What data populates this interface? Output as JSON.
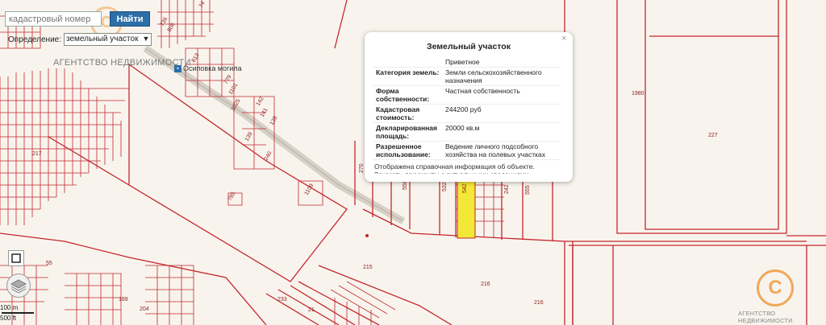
{
  "search": {
    "placeholder": "кадастровый номер",
    "find_label": "Найти"
  },
  "mode": {
    "label": "Определение:",
    "selected": "земельный участок"
  },
  "agency": {
    "name": "АГЕНТСТВО НЕДВИЖИМОСТИ",
    "logo_letter": "С"
  },
  "map": {
    "place_name": "Осиповка могила",
    "parcels": [
      {
        "id": "1980"
      },
      {
        "id": "227"
      },
      {
        "id": "216"
      },
      {
        "id": "216b",
        "label": "216"
      },
      {
        "id": "215"
      },
      {
        "id": "233"
      },
      {
        "id": "21"
      },
      {
        "id": "204"
      },
      {
        "id": "189"
      },
      {
        "id": "55"
      },
      {
        "id": "217"
      },
      {
        "id": "785"
      },
      {
        "id": "1109"
      },
      {
        "id": "240"
      },
      {
        "id": "128"
      },
      {
        "id": "139"
      },
      {
        "id": "141"
      },
      {
        "id": "142"
      },
      {
        "id": "1101"
      },
      {
        "id": "1025"
      },
      {
        "id": "779"
      },
      {
        "id": "813"
      },
      {
        "id": "806"
      },
      {
        "id": "736"
      },
      {
        "id": "74"
      },
      {
        "id": "532"
      },
      {
        "id": "542"
      },
      {
        "id": "242"
      },
      {
        "id": "555"
      },
      {
        "id": "558"
      },
      {
        "id": "270"
      }
    ]
  },
  "controls": {
    "square_icon": "square-toggle-icon",
    "layers_icon": "layers-icon"
  },
  "scale": {
    "label1": "100 m",
    "label2": "500 ft"
  },
  "popup": {
    "title": "Земельный участок",
    "close": "×",
    "rows": [
      {
        "key": "",
        "value": "Приветное"
      },
      {
        "key": "Категория земель:",
        "value": "Земли сельскохозяйственного назначения"
      },
      {
        "key": "Форма собственности:",
        "value": "Частная собственность"
      },
      {
        "key": "Кадастровая стоимость:",
        "value": "244200 руб"
      },
      {
        "key": "Декларированная площадь:",
        "value": "20000 кв.м"
      },
      {
        "key": "Разрешенное использование:",
        "value": "Ведение личного подсобного хозяйства на полевых участках"
      }
    ],
    "note": "Отображена справочная информация об объекте. Заказать документы с актуальными сведениями"
  },
  "colors": {
    "boundary": "#c4262e",
    "highlight": "#f2e837",
    "find_button": "#2d6ea8",
    "logo": "#f0a14a"
  }
}
